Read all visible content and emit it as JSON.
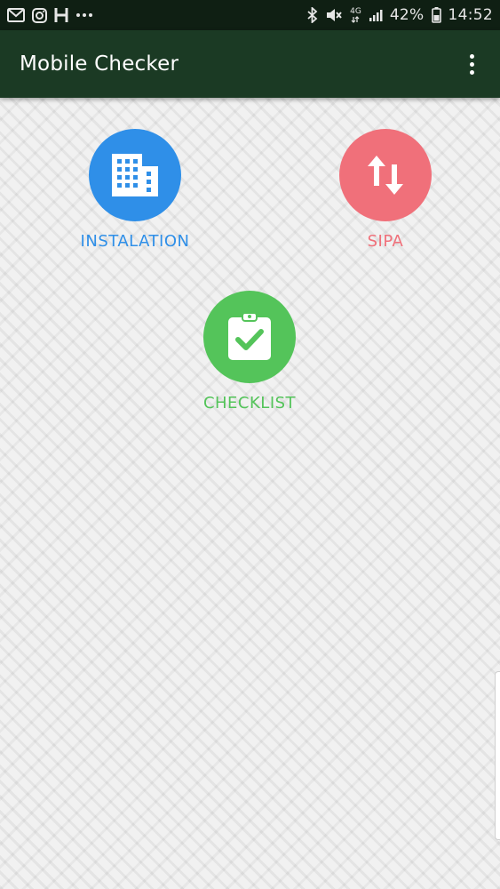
{
  "status_bar": {
    "left_icons": [
      "gmail-icon",
      "instagram-icon",
      "hotel-h-icon",
      "more-dots-icon"
    ],
    "right_icons": [
      "bluetooth-icon",
      "mute-icon",
      "network-4g-icon",
      "signal-icon",
      "battery-icon"
    ],
    "network_label": "4G",
    "battery_percent": "42%",
    "time": "14:52"
  },
  "app_bar": {
    "title": "Mobile Checker",
    "overflow_icon": "more-vert-icon"
  },
  "tiles": [
    {
      "label": "INSTALATION",
      "icon": "building-icon",
      "color": "#2f8fe8"
    },
    {
      "label": "SIPA",
      "icon": "swap-vertical-icon",
      "color": "#f0707a"
    },
    {
      "label": "CHECKLIST",
      "icon": "clipboard-check-icon",
      "color": "#54c45a"
    }
  ],
  "colors": {
    "status_bar": "#0f1f13",
    "app_bar": "#1b3a24",
    "background": "#f1f1f1"
  }
}
